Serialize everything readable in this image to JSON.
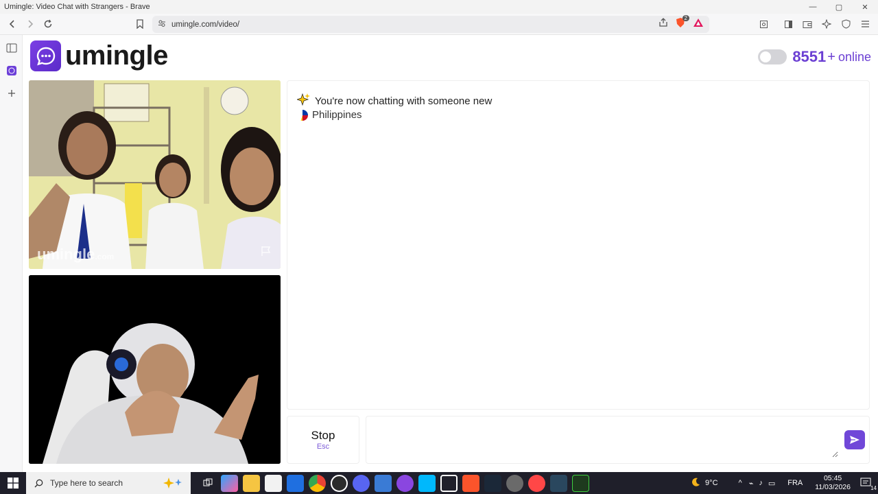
{
  "window": {
    "title": "Umingle: Video Chat with Strangers - Brave",
    "minimize": "—",
    "maximize": "▢",
    "close": "✕"
  },
  "browser": {
    "url": "umingle.com/video/",
    "shields_badge": "2"
  },
  "site": {
    "logo_text": "umingle",
    "online_count": "8551",
    "online_plus": "+",
    "online_label": "online"
  },
  "video": {
    "watermark": "umingle",
    "watermark_suffix": ".com"
  },
  "chat": {
    "status_message": "You're now chatting with someone new",
    "country": "Philippines"
  },
  "controls": {
    "stop_label": "Stop",
    "stop_shortcut": "Esc",
    "message_placeholder": ""
  },
  "taskbar": {
    "search_placeholder": "Type here to search",
    "temperature": "9°C",
    "language": "FRA",
    "time": "05:45",
    "date": "11/03/2026",
    "notification_count": "14"
  },
  "colors": {
    "brand": "#6b3fd3",
    "send_button": "#7047d8"
  }
}
